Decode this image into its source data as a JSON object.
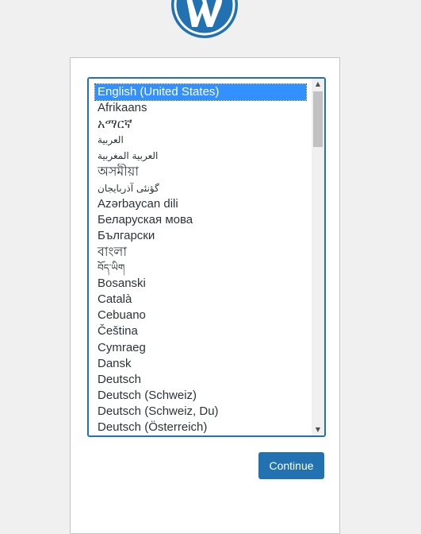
{
  "logo": {
    "icon": "wordpress-logo-icon",
    "color": "#2271b1"
  },
  "language_select": {
    "selected": "English (United States)",
    "options": [
      "English (United States)",
      "Afrikaans",
      "አማርኛ",
      "العربية",
      "العربية المغربية",
      "অসমীয়া",
      "گؤنئی آذربایجان",
      "Azərbaycan dili",
      "Беларуская мова",
      "Български",
      "বাংলা",
      "བོད་ཡིག",
      "Bosanski",
      "Català",
      "Cebuano",
      "Čeština",
      "Cymraeg",
      "Dansk",
      "Deutsch",
      "Deutsch (Schweiz)",
      "Deutsch (Schweiz, Du)",
      "Deutsch (Österreich)"
    ]
  },
  "actions": {
    "continue_label": "Continue"
  },
  "colors": {
    "accent": "#2271b1",
    "background": "#f0f0f1",
    "selection": "#3390ff"
  }
}
